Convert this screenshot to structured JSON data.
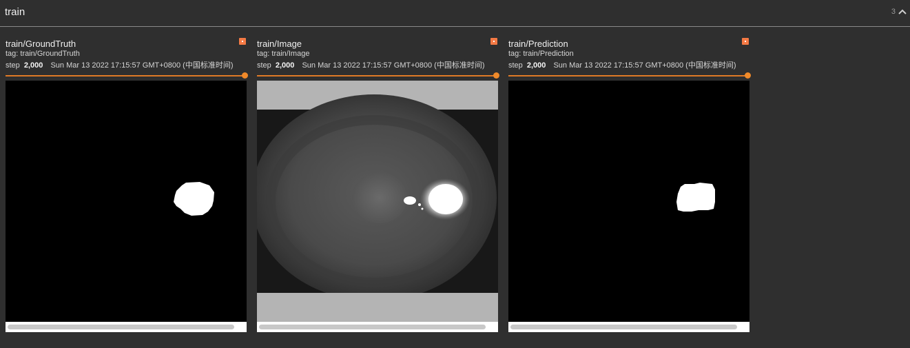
{
  "group": {
    "title": "train",
    "count": "3",
    "collapse_icon": "chevron-up-icon"
  },
  "cards": [
    {
      "title": "train/GroundTruth",
      "tag": "tag: train/GroundTruth",
      "step_label": "step",
      "step_value": "2,000",
      "timestamp": "Sun Mar 13 2022 17:15:57 GMT+0800 (中国标准时间)",
      "image": "white blob mask on black background"
    },
    {
      "title": "train/Image",
      "tag": "tag: train/Image",
      "step_label": "step",
      "step_value": "2,000",
      "timestamp": "Sun Mar 13 2022 17:15:57 GMT+0800 (中国标准时间)",
      "image": "grayscale eye image with gray padding bands"
    },
    {
      "title": "train/Prediction",
      "tag": "tag: train/Prediction",
      "step_label": "step",
      "step_value": "2,000",
      "timestamp": "Sun Mar 13 2022 17:15:57 GMT+0800 (中国标准时间)",
      "image": "white blob mask on black background"
    }
  ],
  "colors": {
    "accent": "#e07a26",
    "pin": "#f47a45",
    "background": "#2f2f2f"
  }
}
